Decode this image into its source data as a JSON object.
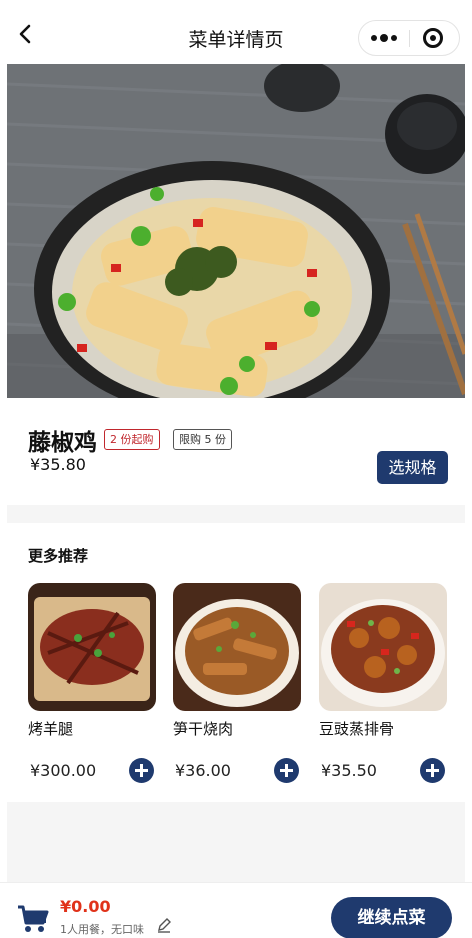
{
  "nav": {
    "title": "菜单详情页",
    "back_icon": "chevron-left-icon",
    "more_icon": "more-dots-icon",
    "close_icon": "target-circle-icon"
  },
  "product": {
    "name": "藤椒鸡",
    "tags": [
      "2 份起购",
      "限购 5 份"
    ],
    "price": "¥35.80",
    "spec_button": "选规格",
    "image": "sichuan-pepper-chicken-photo"
  },
  "recommendations": {
    "title": "更多推荐",
    "items": [
      {
        "name": "烤羊腿",
        "price": "¥300.00",
        "image": "roast-lamb-leg-photo"
      },
      {
        "name": "笋干烧肉",
        "price": "¥36.00",
        "image": "braised-pork-bamboo-photo"
      },
      {
        "name": "豆豉蒸排骨",
        "price": "¥35.50",
        "image": "black-bean-spare-ribs-photo"
      }
    ]
  },
  "bottom_bar": {
    "total": "¥0.00",
    "note": "1人用餐，无口味",
    "continue_button": "继续点菜",
    "cart_icon": "shopping-cart-icon",
    "edit_icon": "pencil-icon"
  },
  "colors": {
    "accent": "#1f3a6e",
    "price_red": "#e0321a",
    "tag_red": "#c0272d",
    "band_gray": "#f5f5f5"
  }
}
